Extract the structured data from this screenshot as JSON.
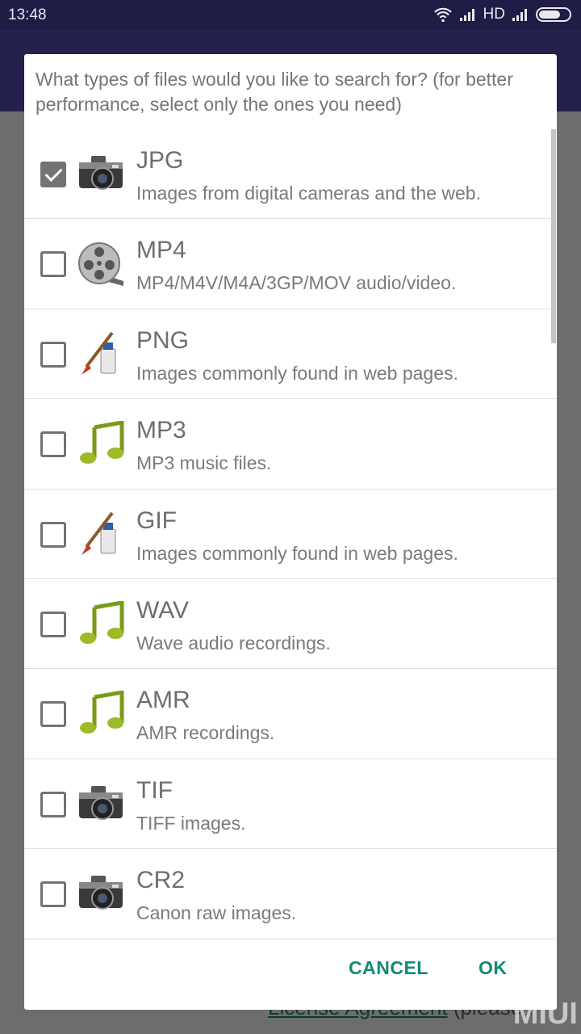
{
  "status_bar": {
    "time": "13:48",
    "network": "HD",
    "icons": [
      "wifi-icon",
      "signal-icon",
      "signal-icon",
      "battery-icon"
    ]
  },
  "background": {
    "link_text": "License Agreement",
    "trailing_text": " (please r",
    "watermark": "MIUI"
  },
  "dialog": {
    "prompt": "What types of files would you like to search for? (for better performance, select only the ones you need)",
    "items": [
      {
        "name": "JPG",
        "desc": "Images from digital cameras and the web.",
        "checked": true,
        "icon": "camera-icon"
      },
      {
        "name": "MP4",
        "desc": "MP4/M4V/M4A/3GP/MOV audio/video.",
        "checked": false,
        "icon": "film-reel-icon"
      },
      {
        "name": "PNG",
        "desc": "Images commonly found in web pages.",
        "checked": false,
        "icon": "paintbrush-icon"
      },
      {
        "name": "MP3",
        "desc": "MP3 music files.",
        "checked": false,
        "icon": "music-note-icon"
      },
      {
        "name": "GIF",
        "desc": "Images commonly found in web pages.",
        "checked": false,
        "icon": "paintbrush-icon"
      },
      {
        "name": "WAV",
        "desc": "Wave audio recordings.",
        "checked": false,
        "icon": "music-note-icon"
      },
      {
        "name": "AMR",
        "desc": "AMR recordings.",
        "checked": false,
        "icon": "music-note-icon"
      },
      {
        "name": "TIF",
        "desc": "TIFF images.",
        "checked": false,
        "icon": "camera-icon"
      },
      {
        "name": "CR2",
        "desc": "Canon raw images.",
        "checked": false,
        "icon": "camera-icon"
      }
    ],
    "cancel_label": "CANCEL",
    "ok_label": "OK"
  },
  "colors": {
    "accent": "#138a76",
    "status_bar": "#1f1c46"
  }
}
